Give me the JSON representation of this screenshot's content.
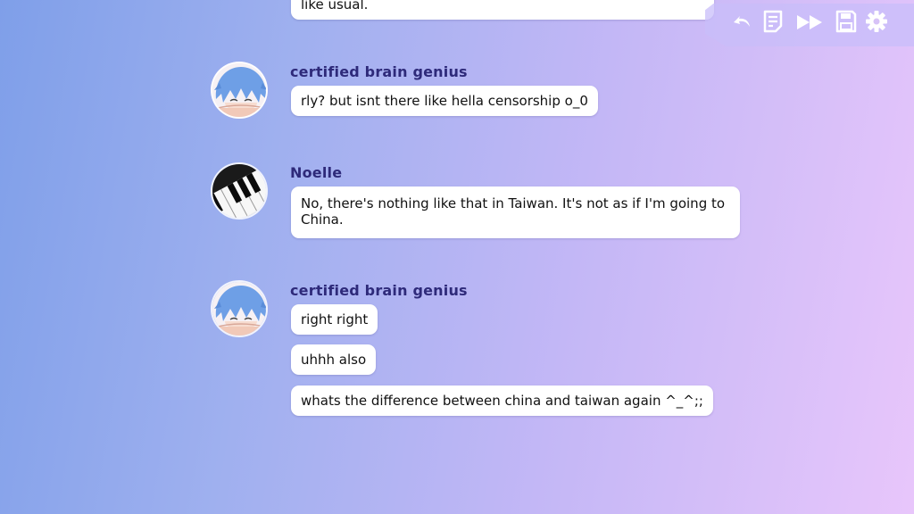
{
  "chat": {
    "prev_tail": "like usual.",
    "messages": [
      {
        "sender": "certified brain genius",
        "lines": [
          "rly? but isnt there like hella censorship o_0"
        ]
      },
      {
        "sender": "Noelle",
        "lines": [
          "No, there's nothing like that in Taiwan. It's not as if I'm going to China."
        ]
      },
      {
        "sender": "certified brain genius",
        "lines": [
          "right right",
          "uhhh also",
          "whats the difference between china and taiwan again ^_^;;"
        ]
      }
    ]
  },
  "quick_menu": {
    "icons": [
      "rollback-icon",
      "history-icon",
      "skip-icon",
      "save-icon",
      "settings-icon"
    ]
  },
  "colors": {
    "username": "#2e2a7a",
    "bubble": "#ffffff",
    "background_start": "#7f9fe9",
    "background_end": "#e8c6fb",
    "menu_icon": "#ffffff"
  }
}
